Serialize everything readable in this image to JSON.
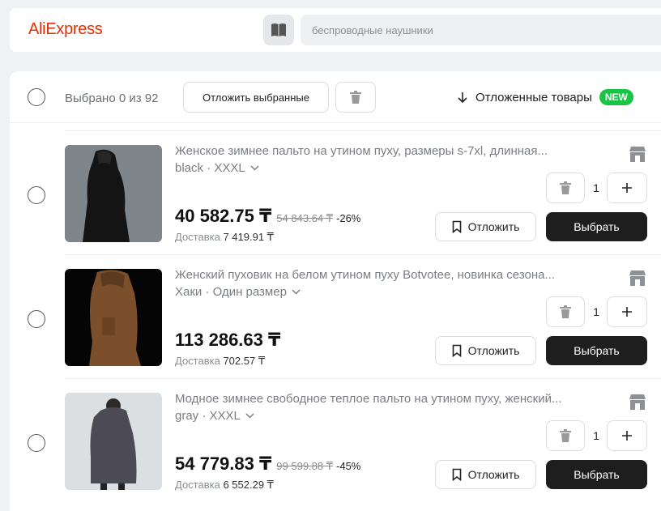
{
  "header": {
    "logo": "AliExpress",
    "search_placeholder": "беспроводные наушники"
  },
  "toolbar": {
    "selected_text": "Выбрано 0 из 92",
    "save_selected_label": "Отложить выбранные",
    "saved_items_label": "Отложенные товары",
    "new_badge": "NEW"
  },
  "items": [
    {
      "title": "Женское зимнее пальто на утином пуху, размеры s-7xl, длинная...",
      "variant": "black · XXXL",
      "price": "40 582.75 ₸",
      "old_price": "54 843.64 ₸",
      "discount": "-26%",
      "delivery_label": "Доставка",
      "delivery_price": "7 419.91 ₸",
      "quantity": "1",
      "save_label": "Отложить",
      "buy_label": "Выбрать"
    },
    {
      "title": "Женский пуховик на белом утином пуху Botvotee, новинка сезона...",
      "variant": "Хаки · Один размер",
      "price": "113 286.63 ₸",
      "old_price": "",
      "discount": "",
      "delivery_label": "Доставка",
      "delivery_price": "702.57 ₸",
      "quantity": "1",
      "save_label": "Отложить",
      "buy_label": "Выбрать"
    },
    {
      "title": "Модное зимнее свободное теплое пальто на утином пуху, женский...",
      "variant": "gray · XXXL",
      "price": "54 779.83 ₸",
      "old_price": "99 599.88 ₸",
      "discount": "-45%",
      "delivery_label": "Доставка",
      "delivery_price": "6 552.29 ₸",
      "quantity": "1",
      "save_label": "Отложить",
      "buy_label": "Выбрать"
    }
  ],
  "colors": {
    "brand": "#e62e04",
    "badge": "#19c444",
    "primary_button": "#1e1e1f"
  }
}
